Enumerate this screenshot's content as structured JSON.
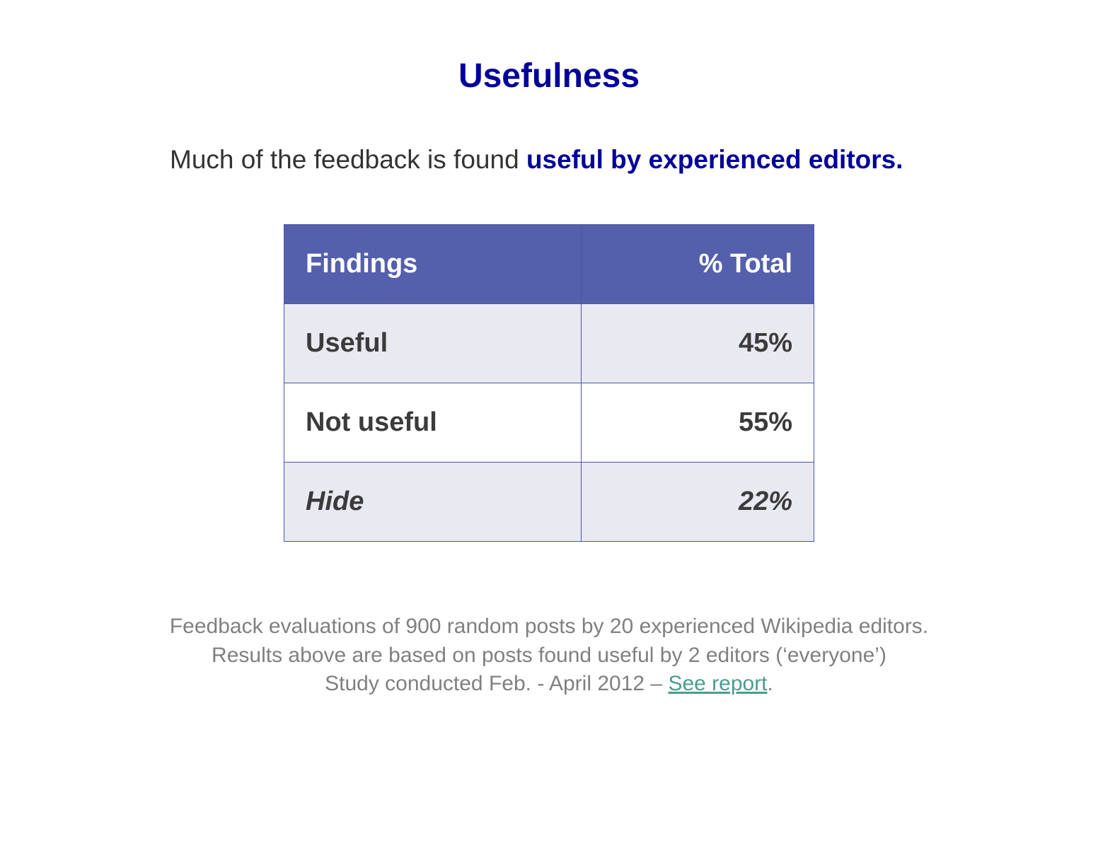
{
  "title": "Usefulness",
  "subtitle": {
    "prefix": "Much of the feedback is found ",
    "emph": "useful by experienced editors."
  },
  "table": {
    "headers": {
      "col1": "Findings",
      "col2": "% Total"
    },
    "rows": [
      {
        "label": "Useful",
        "value": "45%",
        "zebra": "light",
        "italic": false
      },
      {
        "label": "Not useful",
        "value": "55%",
        "zebra": "white",
        "italic": false
      },
      {
        "label": "Hide",
        "value": "22%",
        "zebra": "light",
        "italic": true
      }
    ]
  },
  "chart_data": {
    "type": "table",
    "title": "Usefulness",
    "categories": [
      "Useful",
      "Not useful",
      "Hide"
    ],
    "values": [
      45,
      55,
      22
    ],
    "ylabel": "% Total"
  },
  "footer": {
    "line1": "Feedback evaluations of 900 random posts by 20 experienced Wikipedia editors.",
    "line2": "Results above are based on posts found useful by 2 editors (‘everyone’)",
    "line3_prefix": "Study conducted Feb. - April 2012 – ",
    "link_text": "See report",
    "line3_suffix": "."
  }
}
